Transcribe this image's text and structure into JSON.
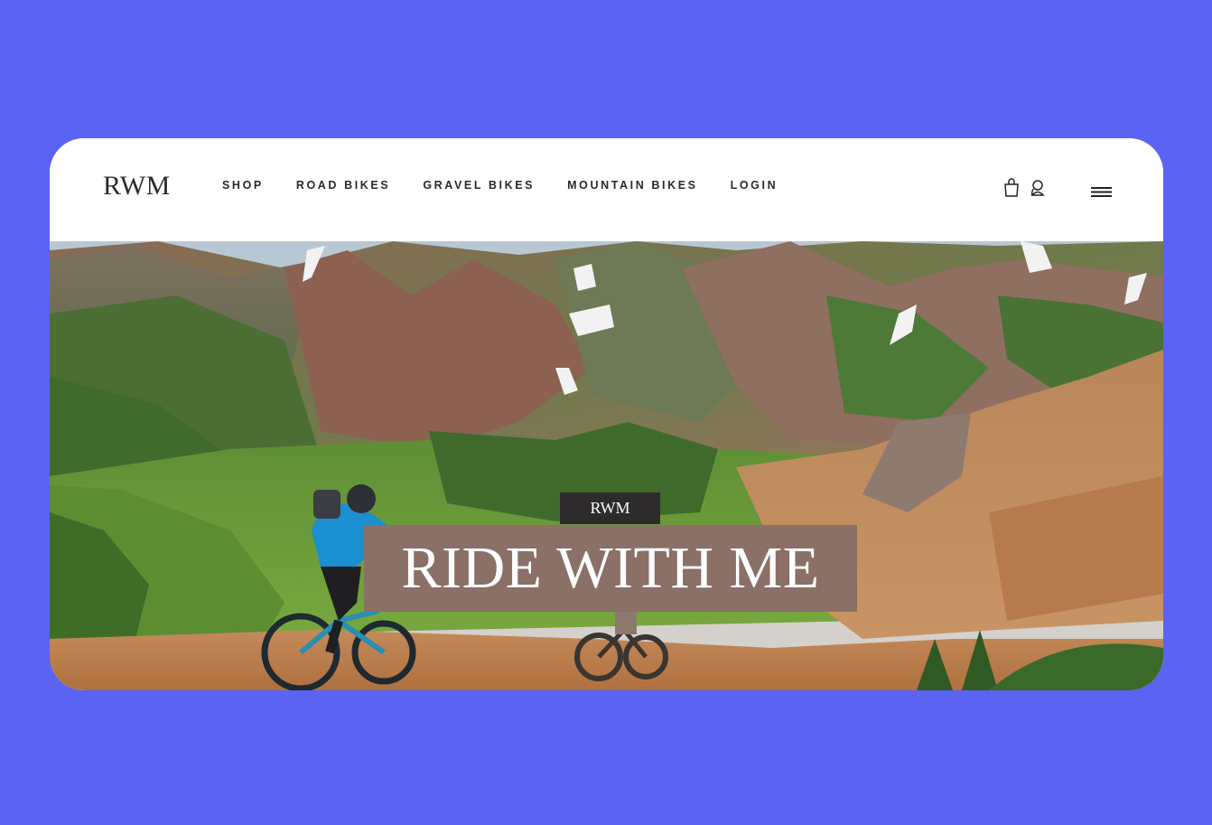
{
  "header": {
    "logo": "RWM",
    "nav": [
      {
        "label": "SHOP"
      },
      {
        "label": "ROAD BIKES"
      },
      {
        "label": "GRAVEL BIKES"
      },
      {
        "label": "MOUNTAIN BIKES"
      },
      {
        "label": "LOGIN"
      }
    ],
    "icons": [
      "shopping-bag-icon",
      "user-icon",
      "hamburger-menu-icon"
    ]
  },
  "hero": {
    "tag": "RWM",
    "headline": "RIDE WITH ME",
    "image": "mountain-bikers-alpine-valley"
  },
  "colors": {
    "background": "#5b63f3",
    "tag_bg": "#2d2b2c",
    "headline_bg": "#8a7066"
  }
}
